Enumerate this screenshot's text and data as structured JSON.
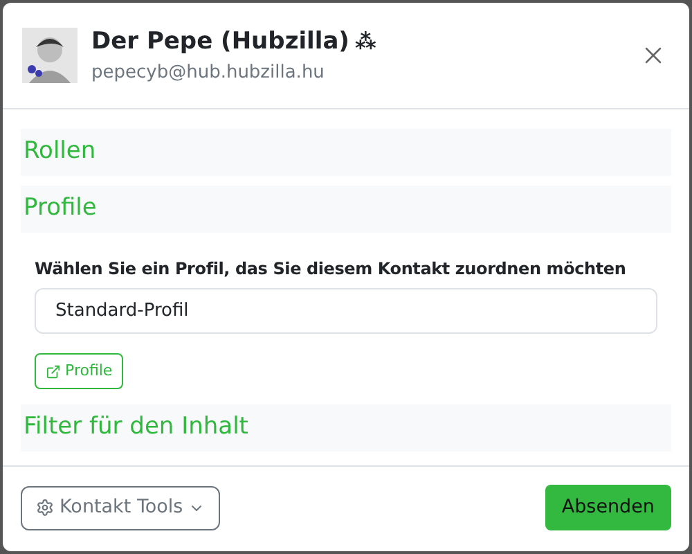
{
  "header": {
    "name": "Der Pepe (Hubzilla)",
    "badge": "⁂",
    "address": "pepecyb@hub.hubzilla.hu"
  },
  "sections": [
    {
      "kind": "header",
      "title": "Rollen"
    },
    {
      "kind": "header",
      "title": "Profile"
    },
    {
      "kind": "profile",
      "label": "Wählen Sie ein Profil, das Sie diesem Kontakt zuordnen möchten",
      "value": "Standard-Profil",
      "link": "Profile"
    },
    {
      "kind": "header",
      "title": "Filter für den Inhalt"
    }
  ],
  "footer": {
    "tools": "Kontakt Tools",
    "submit": "Absenden"
  }
}
